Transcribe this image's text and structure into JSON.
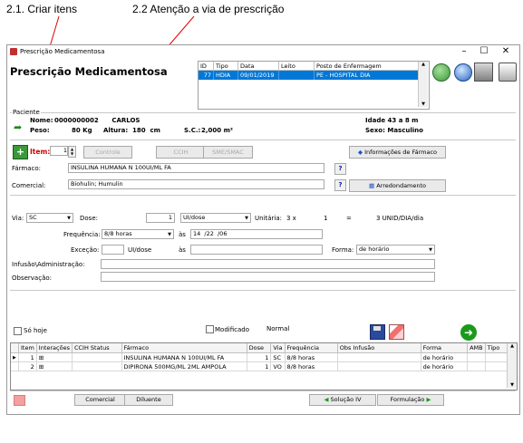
{
  "annotations": {
    "step1": "2.1.  Criar itens",
    "step2": "2.2  Atenção a via de prescrição"
  },
  "window": {
    "title": "Prescrição Medicamentosa",
    "controls": [
      "–",
      "☐",
      "✕"
    ]
  },
  "header": {
    "title": "Prescrição Medicamentosa"
  },
  "admissions": {
    "columns": [
      "ID",
      "Tipo",
      "Data",
      "Leito",
      "Posto de Enfermagem"
    ],
    "rows": [
      [
        "77",
        "HDIA",
        "09/01/2019",
        "",
        "PE - HOSPITAL DIA"
      ]
    ]
  },
  "patient": {
    "section_label": "Paciente",
    "name_label": "Nome:",
    "name_value": "0000000002      CARLOS",
    "weight_label": "Peso:",
    "weight_value": "80 Kg",
    "height_label": "Altura:",
    "height_value": "180  cm",
    "sc_label": "S.C.:",
    "sc_value": "2,000 m²",
    "age": "Idade 43 a 8 m",
    "sex": "Sexo: Masculino"
  },
  "item": {
    "label": "Item:",
    "value": "1",
    "buttons": {
      "controle": "Controle",
      "ccih": "CCIH",
      "sme": "SME/SMAC",
      "info": "Informações de Fármaco",
      "arredondamento": "Arredondamento"
    },
    "farmaco_label": "Fármaco:",
    "farmaco_value": "INSULINA HUMANA N 100UI/ML FA",
    "comercial_label": "Comercial:",
    "comercial_value": "Biohulin; Humulin",
    "q": "?"
  },
  "dosing": {
    "via_label": "Via:",
    "via_value": "SC",
    "dose_label": "Dose:",
    "dose_value": "1",
    "dose_unit": "UI/dose",
    "unitaria_label": "Unitária:",
    "unitaria_x": "3 x",
    "unitaria_n": "1",
    "unitaria_eq": "=",
    "unitaria_total": "3 UNID/DIA/dia",
    "freq_label": "Frequência:",
    "freq_value": "8/8 horas",
    "as_label": "às",
    "as_value": "14  /22  /06",
    "excecao_label": "Exceção:",
    "excecao_unit": "UI/dose",
    "excecao_as": "às",
    "forma_label": "Forma:",
    "forma_value": "de horário",
    "infusao_label": "Infusão\\Administração:",
    "observacao_label": "Observação:"
  },
  "options": {
    "so_hoje": "Só hoje",
    "modificado": "Modificado",
    "normal": "Normal"
  },
  "items_grid": {
    "columns": [
      "Item",
      "Interações",
      "CCIH Status",
      "Fármaco",
      "Dose",
      "Via",
      "Frequência",
      "Obs Infusão",
      "Forma",
      "AMB",
      "Tipo"
    ],
    "rows": [
      [
        "1",
        "⊞",
        "",
        "INSULINA HUMANA N 100UI/ML FA",
        "1",
        "SC",
        "8/8 horas",
        "",
        "de horário",
        "",
        ""
      ],
      [
        "2",
        "⊞",
        "",
        "DIPIRONA 500MG/ML 2ML AMPOLA",
        "1",
        "VO",
        "8/8 horas",
        "",
        "de horário",
        "",
        ""
      ]
    ]
  },
  "footer": {
    "comercial": "Comercial",
    "diluente": "Diluente",
    "solucao": "Solução IV",
    "formulacao": "Formulação"
  },
  "colors": {
    "selection": "#0078d7",
    "item_red": "#d00000",
    "arrow_green": "#1a9a1a"
  }
}
